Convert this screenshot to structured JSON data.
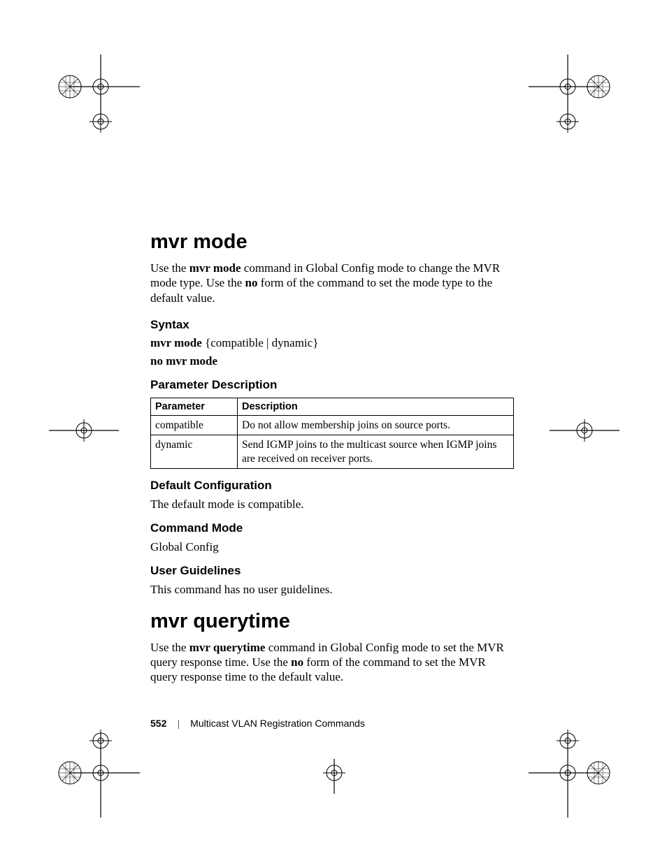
{
  "section1": {
    "title": "mvr mode",
    "intro_pre": "Use the ",
    "intro_bold1": "mvr mode",
    "intro_mid": " command in Global Config mode to change the MVR mode type. Use the ",
    "intro_bold2": "no",
    "intro_post": " form of the command to set the mode type to the default value.",
    "syntax_heading": "Syntax",
    "syntax_line1_bold": "mvr mode",
    "syntax_line1_rest": " {compatible | dynamic}",
    "syntax_line2": "no mvr mode",
    "param_heading": "Parameter Description",
    "table": {
      "head_param": "Parameter",
      "head_desc": "Description",
      "rows": [
        {
          "param": "compatible",
          "desc": "Do not allow membership joins on source ports."
        },
        {
          "param": "dynamic",
          "desc": "Send IGMP joins to the multicast source when IGMP joins are received on receiver ports."
        }
      ]
    },
    "defcfg_heading": "Default Configuration",
    "defcfg_body": "The default mode is compatible.",
    "cmdmode_heading": "Command Mode",
    "cmdmode_body": "Global Config",
    "ug_heading": "User Guidelines",
    "ug_body": "This command has no user guidelines."
  },
  "section2": {
    "title": "mvr querytime",
    "intro_pre": "Use the ",
    "intro_bold1": "mvr querytime",
    "intro_mid": " command in Global Config mode to set the MVR query response time. Use the ",
    "intro_bold2": "no",
    "intro_post": " form of the command to set the MVR query response time to the default value."
  },
  "footer": {
    "page": "552",
    "sep": "|",
    "title": "Multicast VLAN Registration Commands"
  }
}
